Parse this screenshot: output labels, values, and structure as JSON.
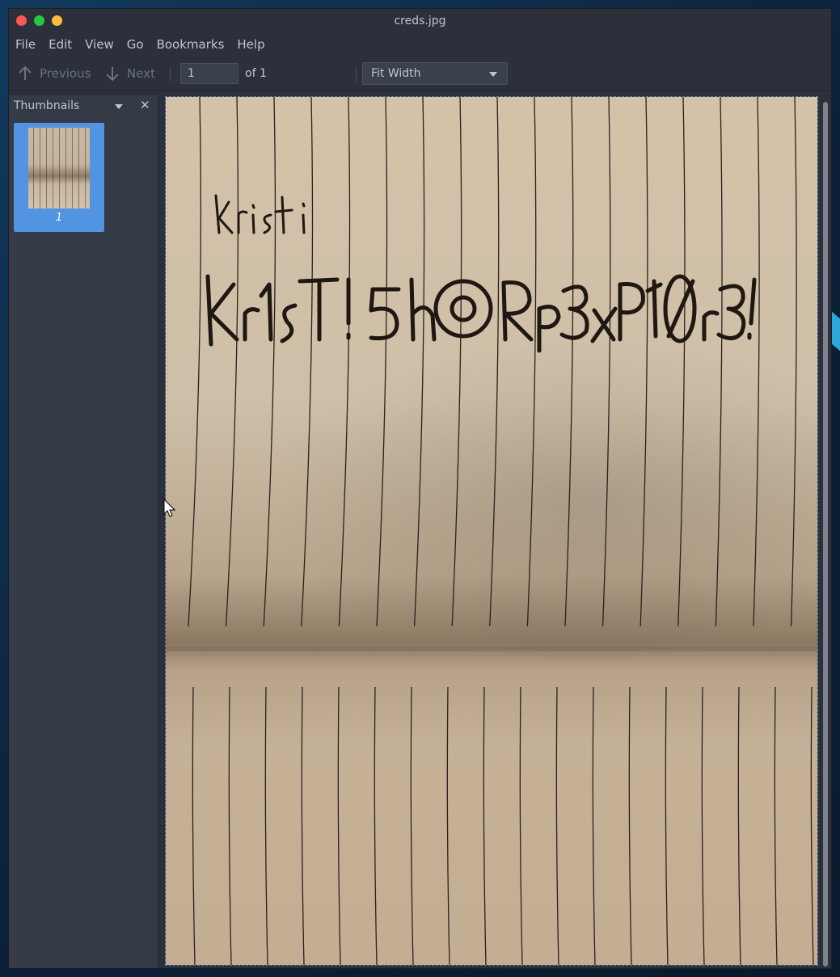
{
  "window": {
    "title": "creds.jpg"
  },
  "menubar": {
    "items": [
      "File",
      "Edit",
      "View",
      "Go",
      "Bookmarks",
      "Help"
    ]
  },
  "toolbar": {
    "previous_label": "Previous",
    "next_label": "Next",
    "page_value": "1",
    "page_total": "of 1",
    "zoom_value": "Fit Width"
  },
  "sidebar": {
    "title": "Thumbnails",
    "close_glyph": "✕",
    "thumbnails": [
      {
        "label": "1"
      }
    ]
  },
  "colors": {
    "window_bg": "#2b303b",
    "sidebar_bg": "#343a46",
    "selection": "#5294e2",
    "text": "#c0c5ce",
    "close": "#fc5753",
    "maximize": "#28c941",
    "minimize": "#fdbc40"
  },
  "icons": [
    "arrow-up-icon",
    "arrow-down-icon",
    "chevron-down-icon",
    "close-icon",
    "pointer-cursor-icon"
  ],
  "document": {
    "content": "photo of lined notebook paper with handwritten text",
    "handwriting_line1": "Kristi",
    "handwriting_line2": "Kr1sT!5h@Rp3xPl0r3!"
  }
}
